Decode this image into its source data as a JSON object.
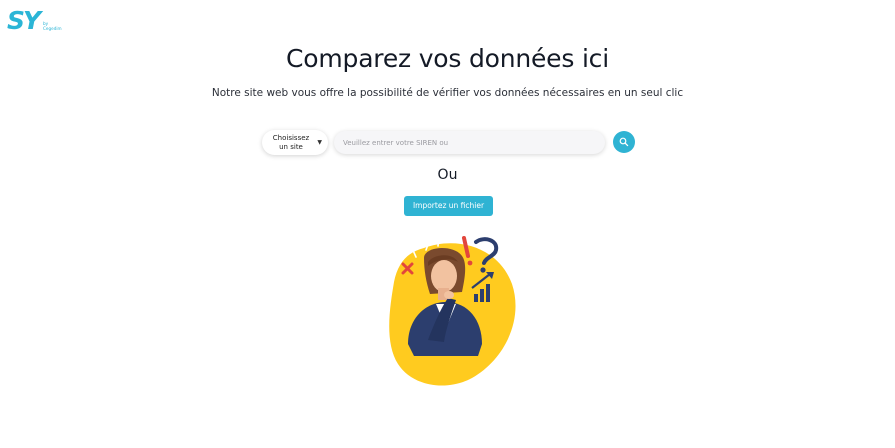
{
  "logo": {
    "main": "SY",
    "sub_line1": "by",
    "sub_line2": "Cegedim"
  },
  "header": {
    "title": "Comparez vos données ici",
    "subtitle": "Notre site web vous offre la possibilité de vérifier vos données nécessaires en un seul clic"
  },
  "search": {
    "site_select_label": "Choisissez un site",
    "placeholder": "Veuillez entrer votre SIREN ou"
  },
  "divider_label": "Ou",
  "import_button_label": "Importez un fichier",
  "colors": {
    "accent": "#2fb3d3",
    "logo": "#2bb5d6",
    "illustration_yellow": "#ffcb1f",
    "illustration_navy": "#2c3e6e",
    "illustration_red": "#e2463c"
  }
}
